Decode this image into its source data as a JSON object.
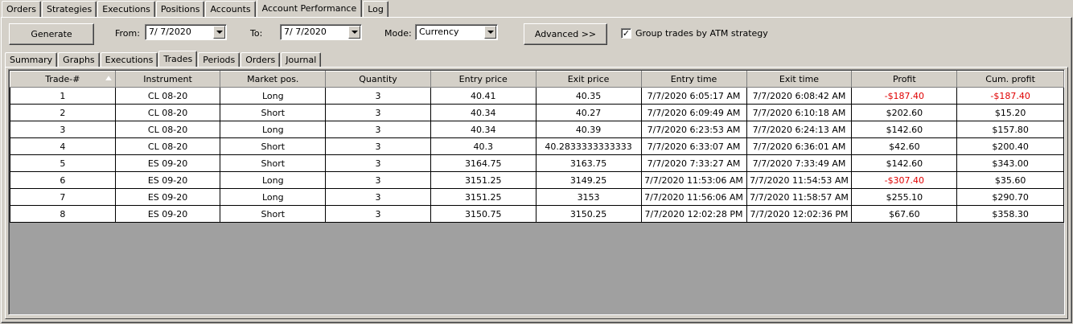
{
  "top_tabs": [
    "Orders",
    "Strategies",
    "Executions",
    "Positions",
    "Accounts",
    "Account Performance",
    "Log"
  ],
  "active_top_tab": "Account Performance",
  "toolbar": {
    "generate_label": "Generate",
    "from_label": "From:",
    "from_value": "7/  7/2020",
    "to_label": "To:",
    "to_value": "7/  7/2020",
    "mode_label": "Mode:",
    "mode_value": "Currency",
    "advanced_label": "Advanced >>",
    "group_label": "Group trades by ATM strategy",
    "group_checked": true
  },
  "sub_tabs": [
    "Summary",
    "Graphs",
    "Executions",
    "Trades",
    "Periods",
    "Orders",
    "Journal"
  ],
  "active_sub_tab": "Trades",
  "table": {
    "columns": [
      "Trade-#",
      "Instrument",
      "Market pos.",
      "Quantity",
      "Entry price",
      "Exit price",
      "Entry time",
      "Exit time",
      "Profit",
      "Cum. profit"
    ],
    "sorted_column": "Trade-#",
    "rows": [
      [
        "1",
        "CL 08-20",
        "Long",
        "3",
        "40.41",
        "40.35",
        "7/7/2020 6:05:17 AM",
        "7/7/2020 6:08:42 AM",
        "-$187.40",
        "-$187.40"
      ],
      [
        "2",
        "CL 08-20",
        "Short",
        "3",
        "40.34",
        "40.27",
        "7/7/2020 6:09:49 AM",
        "7/7/2020 6:10:18 AM",
        "$202.60",
        "$15.20"
      ],
      [
        "3",
        "CL 08-20",
        "Long",
        "3",
        "40.34",
        "40.39",
        "7/7/2020 6:23:53 AM",
        "7/7/2020 6:24:13 AM",
        "$142.60",
        "$157.80"
      ],
      [
        "4",
        "CL 08-20",
        "Short",
        "3",
        "40.3",
        "40.2833333333333",
        "7/7/2020 6:33:07 AM",
        "7/7/2020 6:36:01 AM",
        "$42.60",
        "$200.40"
      ],
      [
        "5",
        "ES 09-20",
        "Short",
        "3",
        "3164.75",
        "3163.75",
        "7/7/2020 7:33:27 AM",
        "7/7/2020 7:33:49 AM",
        "$142.60",
        "$343.00"
      ],
      [
        "6",
        "ES 09-20",
        "Long",
        "3",
        "3151.25",
        "3149.25",
        "7/7/2020 11:53:06 AM",
        "7/7/2020 11:54:53 AM",
        "-$307.40",
        "$35.60"
      ],
      [
        "7",
        "ES 09-20",
        "Long",
        "3",
        "3151.25",
        "3153",
        "7/7/2020 11:56:06 AM",
        "7/7/2020 11:58:57 AM",
        "$255.10",
        "$290.70"
      ],
      [
        "8",
        "ES 09-20",
        "Short",
        "3",
        "3150.75",
        "3150.25",
        "7/7/2020 12:02:28 PM",
        "7/7/2020 12:02:36 PM",
        "$67.60",
        "$358.30"
      ]
    ]
  },
  "colors": {
    "negative": "#e00000",
    "window_bg": "#d4d0c8",
    "grid_empty_bg": "#a0a0a0"
  }
}
